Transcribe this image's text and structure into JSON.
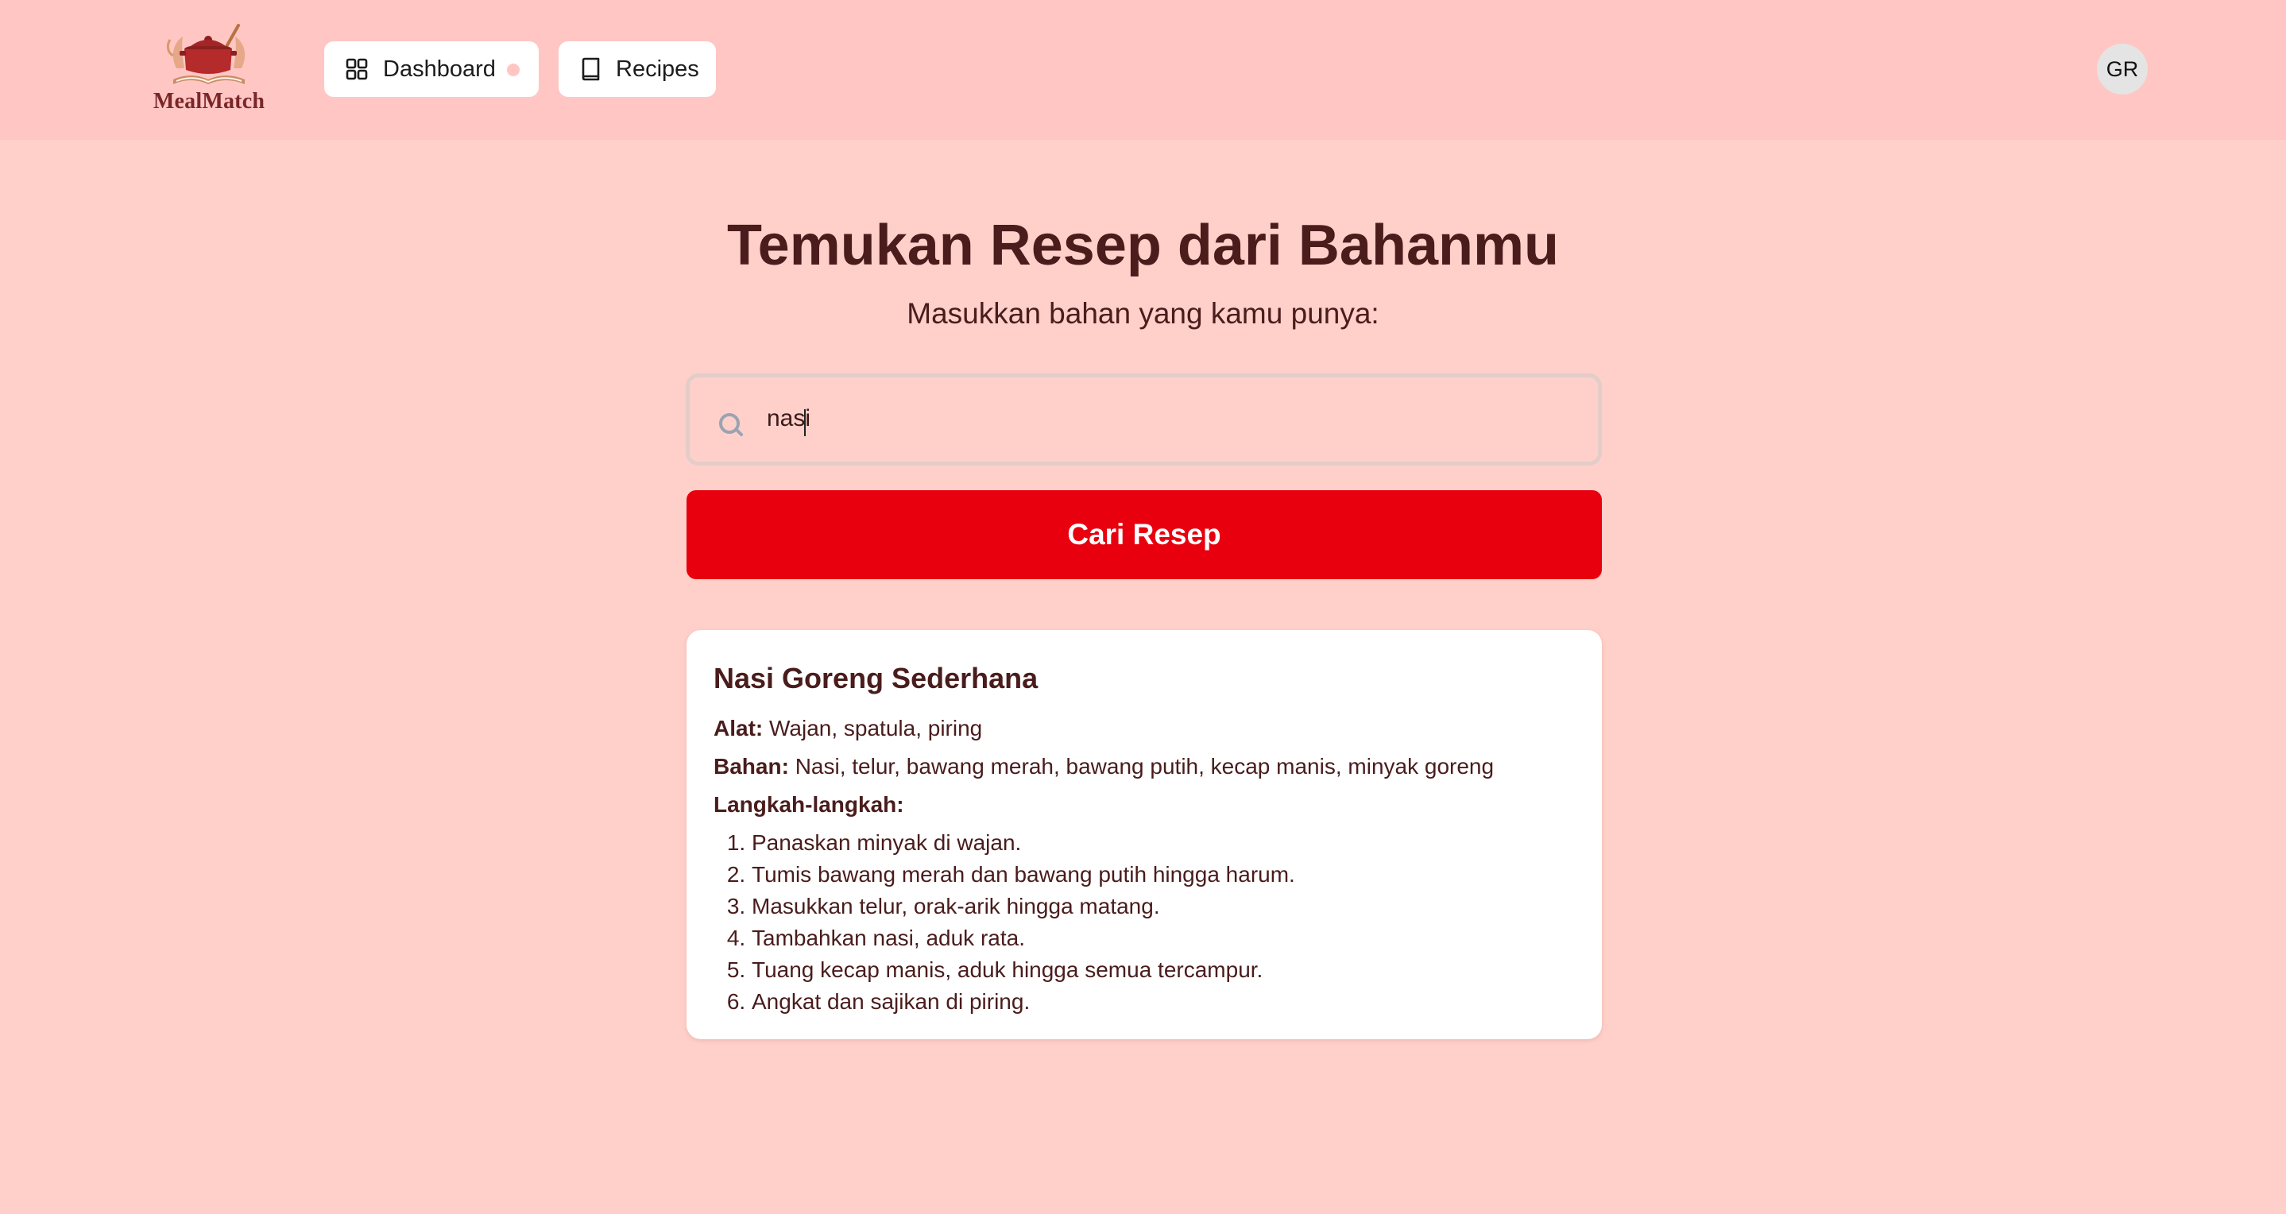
{
  "header": {
    "brand": "MealMatch",
    "nav": [
      {
        "label": "Dashboard",
        "icon": "grid-icon"
      },
      {
        "label": "Recipes",
        "icon": "book-icon"
      }
    ],
    "avatar_initials": "GR"
  },
  "main": {
    "title": "Temukan Resep dari Bahanmu",
    "subtitle": "Masukkan bahan yang kamu punya:",
    "search": {
      "value": "nasi",
      "placeholder": ""
    },
    "search_button": "Cari Resep"
  },
  "result": {
    "title": "Nasi Goreng Sederhana",
    "tools_label": "Alat:",
    "tools": "Wajan, spatula, piring",
    "ingredients_label": "Bahan:",
    "ingredients": "Nasi, telur, bawang merah, bawang putih, kecap manis, minyak goreng",
    "steps_label": "Langkah-langkah:",
    "steps": [
      "Panaskan minyak di wajan.",
      "Tumis bawang merah dan bawang putih hingga harum.",
      "Masukkan telur, orak-arik hingga matang.",
      "Tambahkan nasi, aduk rata.",
      "Tuang kecap manis, aduk hingga semua tercampur.",
      "Angkat dan sajikan di piring."
    ]
  },
  "colors": {
    "page_bg": "#ffd0ca",
    "header_bg": "#ffc6c4",
    "accent": "#e8000f",
    "text": "#4a1c1c"
  }
}
